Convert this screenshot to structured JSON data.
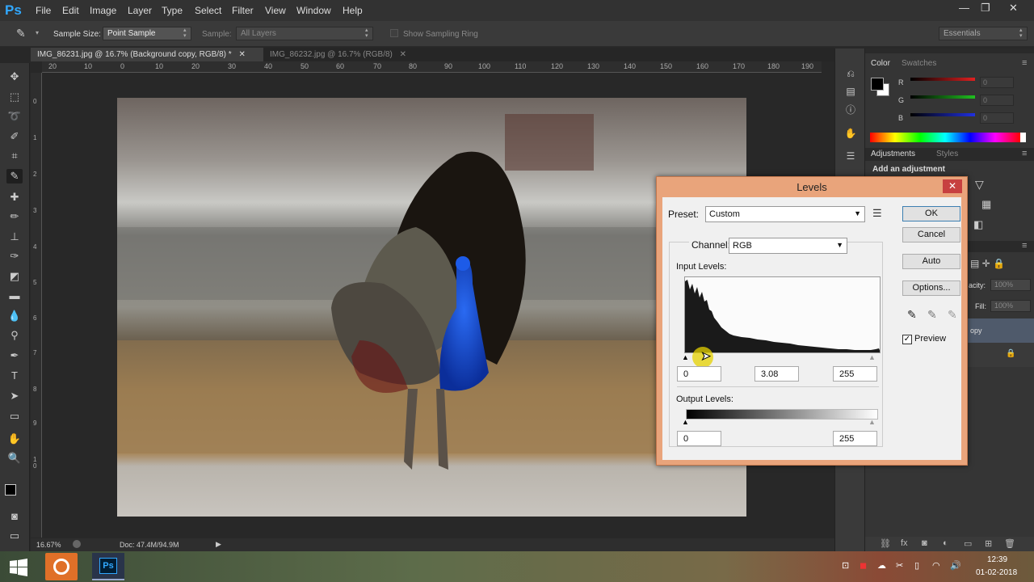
{
  "app": {
    "logo": "Ps"
  },
  "menu": [
    "File",
    "Edit",
    "Image",
    "Layer",
    "Type",
    "Select",
    "Filter",
    "View",
    "Window",
    "Help"
  ],
  "window_controls": [
    "—",
    "❐",
    "✕"
  ],
  "options_bar": {
    "sample_size_label": "Sample Size:",
    "sample_size_value": "Point Sample",
    "sample_label": "Sample:",
    "sample_value": "All Layers",
    "show_ring_label": "Show Sampling Ring",
    "workspace": "Essentials"
  },
  "tabs": [
    {
      "label": "IMG_86231.jpg @ 16.7% (Background copy, RGB/8) *",
      "active": true
    },
    {
      "label": "IMG_86232.jpg @ 16.7% (RGB/8)",
      "active": false
    }
  ],
  "ruler_top": [
    "20",
    "10",
    "0",
    "10",
    "20",
    "30",
    "40",
    "50",
    "60",
    "70",
    "80",
    "90",
    "100",
    "110",
    "120",
    "130",
    "140",
    "150",
    "160",
    "170",
    "180",
    "190"
  ],
  "ruler_left": [
    "0",
    "1",
    "2",
    "3",
    "4",
    "5",
    "6",
    "7",
    "8",
    "9",
    "10"
  ],
  "status": {
    "zoom": "16.67%",
    "doc": "Doc: 47.4M/94.9M"
  },
  "color_panel": {
    "tabs": [
      "Color",
      "Swatches"
    ],
    "channels": [
      {
        "label": "R",
        "value": "0",
        "color": "#e02020"
      },
      {
        "label": "G",
        "value": "0",
        "color": "#20c020"
      },
      {
        "label": "B",
        "value": "0",
        "color": "#2030e0"
      }
    ]
  },
  "adjustments_panel": {
    "tabs": [
      "Adjustments",
      "Styles"
    ],
    "heading": "Add an adjustment"
  },
  "layers_panel": {
    "opacity_label": "acity:",
    "opacity": "100%",
    "fill_label": "Fill:",
    "fill": "100%",
    "layer_name": "opy"
  },
  "levels": {
    "title": "Levels",
    "preset_label": "Preset:",
    "preset_value": "Custom",
    "channel_label": "Channel:",
    "channel_value": "RGB",
    "input_label": "Input Levels:",
    "input_black": "0",
    "input_gamma": "3.08",
    "input_white": "255",
    "output_label": "Output Levels:",
    "output_black": "0",
    "output_white": "255",
    "buttons": {
      "ok": "OK",
      "cancel": "Cancel",
      "auto": "Auto",
      "options": "Options..."
    },
    "preview_label": "Preview",
    "preview_checked": true
  },
  "taskbar": {
    "time": "12:39",
    "date": "01-02-2018"
  }
}
